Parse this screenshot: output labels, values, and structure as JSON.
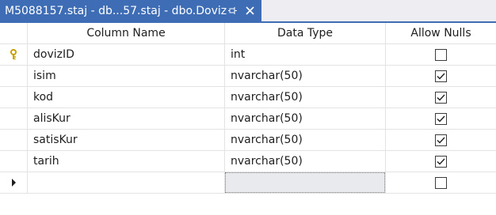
{
  "tab": {
    "title": "M5088157.staj - db...57.staj - dbo.Doviz",
    "pin_icon": "pin-icon",
    "close_icon": "close-icon"
  },
  "grid": {
    "headers": {
      "column_name": "Column Name",
      "data_type": "Data Type",
      "allow_nulls": "Allow Nulls"
    },
    "rows": [
      {
        "name": "dovizID",
        "type": "int",
        "allow_nulls": false,
        "primary_key": true
      },
      {
        "name": "isim",
        "type": "nvarchar(50)",
        "allow_nulls": true,
        "primary_key": false
      },
      {
        "name": "kod",
        "type": "nvarchar(50)",
        "allow_nulls": true,
        "primary_key": false
      },
      {
        "name": "alisKur",
        "type": "nvarchar(50)",
        "allow_nulls": true,
        "primary_key": false
      },
      {
        "name": "satisKur",
        "type": "nvarchar(50)",
        "allow_nulls": true,
        "primary_key": false
      },
      {
        "name": "tarih",
        "type": "nvarchar(50)",
        "allow_nulls": true,
        "primary_key": false
      }
    ],
    "new_row": {
      "name": "",
      "type": "",
      "allow_nulls": false
    }
  },
  "colors": {
    "tab_active": "#3e6db5",
    "tabstrip_bg": "#eeeef2",
    "key_icon": "#c8a000"
  }
}
